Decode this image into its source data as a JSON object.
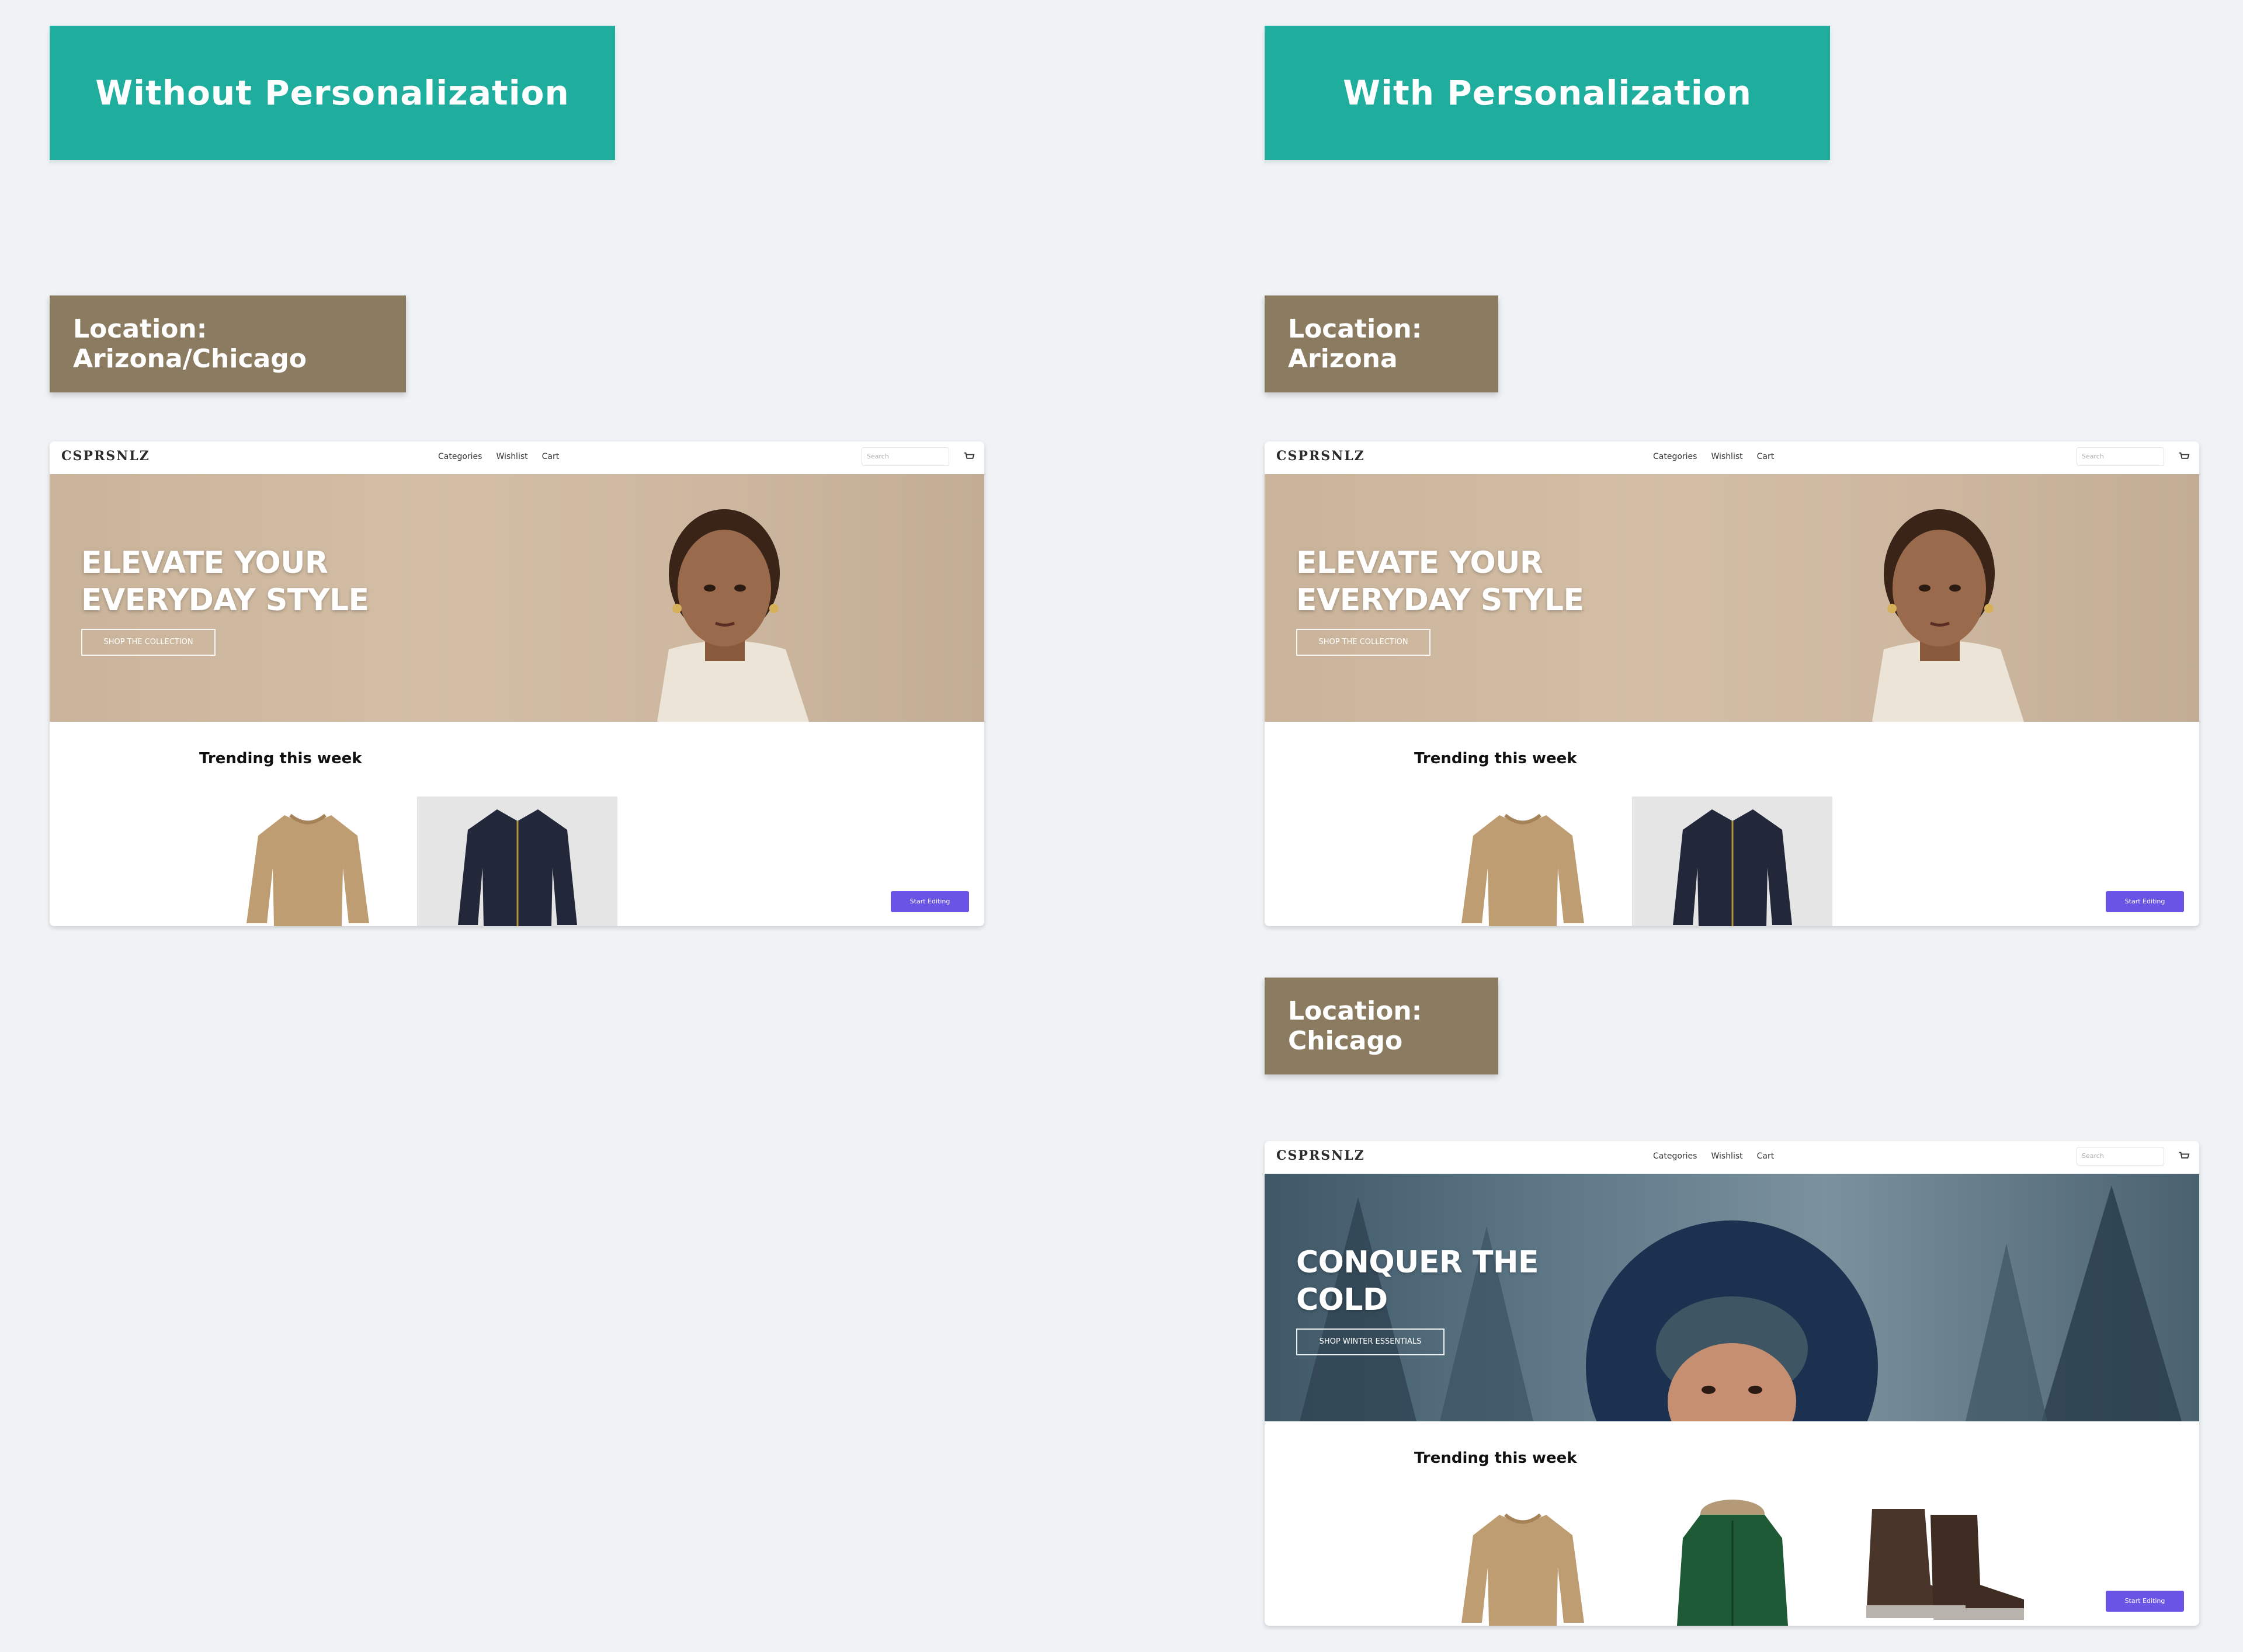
{
  "columns": {
    "left_header": "Without Personalization",
    "right_header": "With Personalization"
  },
  "locations": {
    "combined": "Location: Arizona/Chicago",
    "arizona": "Location: Arizona",
    "chicago": "Location: Chicago"
  },
  "site": {
    "logo": "CSPRSNLZ",
    "nav_links": [
      "Categories",
      "Wishlist",
      "Cart"
    ],
    "search_placeholder": "Search",
    "trending_title": "Trending this week",
    "edit_button": "Start Editing"
  },
  "hero_default": {
    "title_line1": "ELEVATE YOUR",
    "title_line2": "EVERYDAY STYLE",
    "button": "SHOP THE COLLECTION"
  },
  "hero_winter": {
    "title_line1": "CONQUER THE",
    "title_line2": "COLD",
    "button": "SHOP WINTER ESSENTIALS"
  },
  "colors": {
    "header_teal": "#1fae9e",
    "location_badge": "#8b7b60",
    "edit_button": "#6a54e6",
    "background": "#f0f3f6"
  }
}
